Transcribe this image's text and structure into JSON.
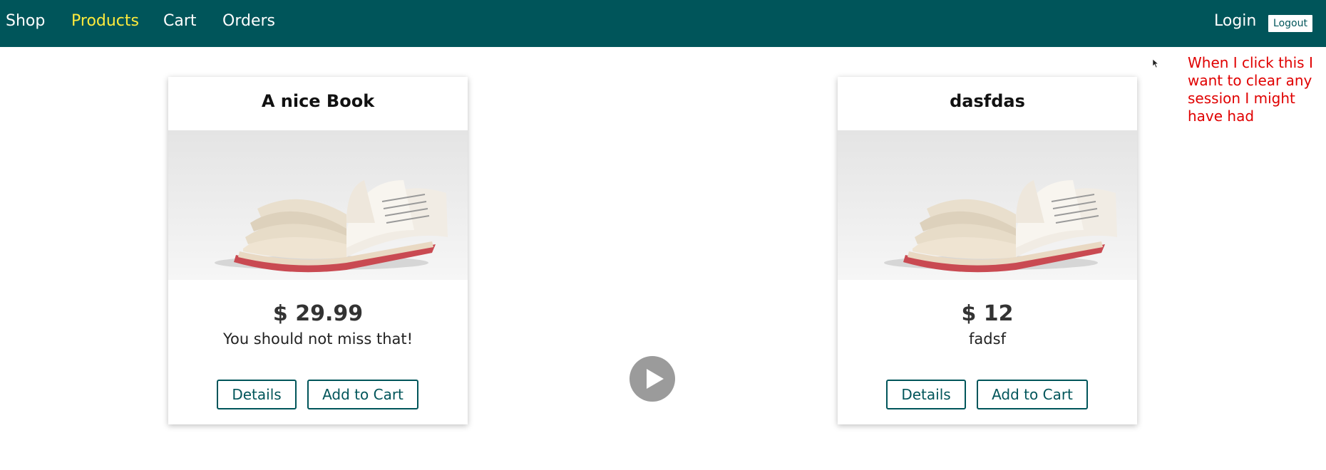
{
  "nav": {
    "items": [
      {
        "label": "Shop",
        "active": false
      },
      {
        "label": "Products",
        "active": true
      },
      {
        "label": "Cart",
        "active": false
      },
      {
        "label": "Orders",
        "active": false
      }
    ],
    "login_label": "Login",
    "logout_label": "Logout"
  },
  "annotation": {
    "text": "When I click this I want to clear any session I might have had"
  },
  "products": [
    {
      "title": "A nice Book",
      "price": "$ 29.99",
      "description": "You should not miss that!",
      "details_label": "Details",
      "add_to_cart_label": "Add to Cart",
      "image": "open-book-image"
    },
    {
      "title": "dasfdas",
      "price": "$ 12",
      "description": "fadsf",
      "details_label": "Details",
      "add_to_cart_label": "Add to Cart",
      "image": "open-book-image"
    }
  ],
  "video": {
    "control": "play-icon"
  },
  "colors": {
    "nav_bg": "#00555a",
    "nav_active": "#ffeb3b",
    "button_border": "#00555a",
    "annotation": "#e00000"
  }
}
